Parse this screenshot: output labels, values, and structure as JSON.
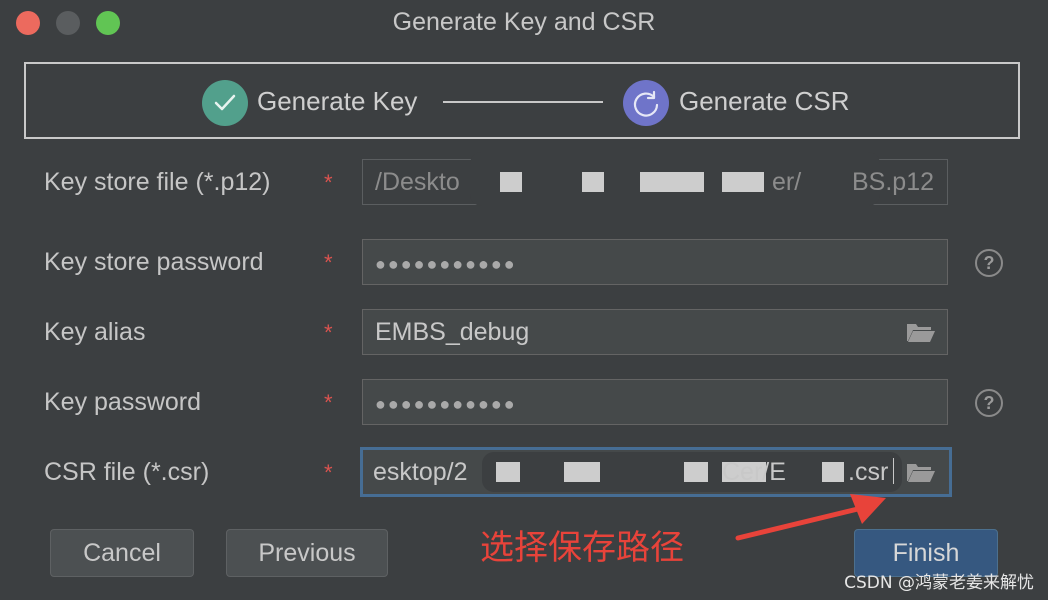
{
  "window": {
    "title": "Generate Key and CSR"
  },
  "stepper": {
    "steps": [
      {
        "label": "Generate Key",
        "state": "completed",
        "icon": "checkmark-icon",
        "color": "#52a08c"
      },
      {
        "label": "Generate CSR",
        "state": "in-progress",
        "icon": "spinner-icon",
        "color": "#6f74c9"
      }
    ]
  },
  "form": {
    "required_marker": "*",
    "key_store_file": {
      "label": "Key store file (*.p12)",
      "value": "/Deskto",
      "value_tail": "er/",
      "value_end": "BS.p12",
      "disabled": true
    },
    "key_store_password": {
      "label": "Key store password",
      "value": "●●●●●●●●●●●",
      "help": "?"
    },
    "key_alias": {
      "label": "Key alias",
      "value": "EMBS_debug"
    },
    "key_password": {
      "label": "Key password",
      "value": "●●●●●●●●●●●",
      "help": "?"
    },
    "csr_file": {
      "label": "CSR file (*.csr)",
      "value": "esktop/2",
      "value_tail": "Cer/E",
      "value_end": ".csr",
      "focused": true
    }
  },
  "buttons": {
    "cancel": "Cancel",
    "previous": "Previous",
    "finish": "Finish"
  },
  "annotation": {
    "text": "选择保存路径",
    "color": "#e8433a"
  },
  "watermark": "CSDN @鸿蒙老姜来解忧"
}
